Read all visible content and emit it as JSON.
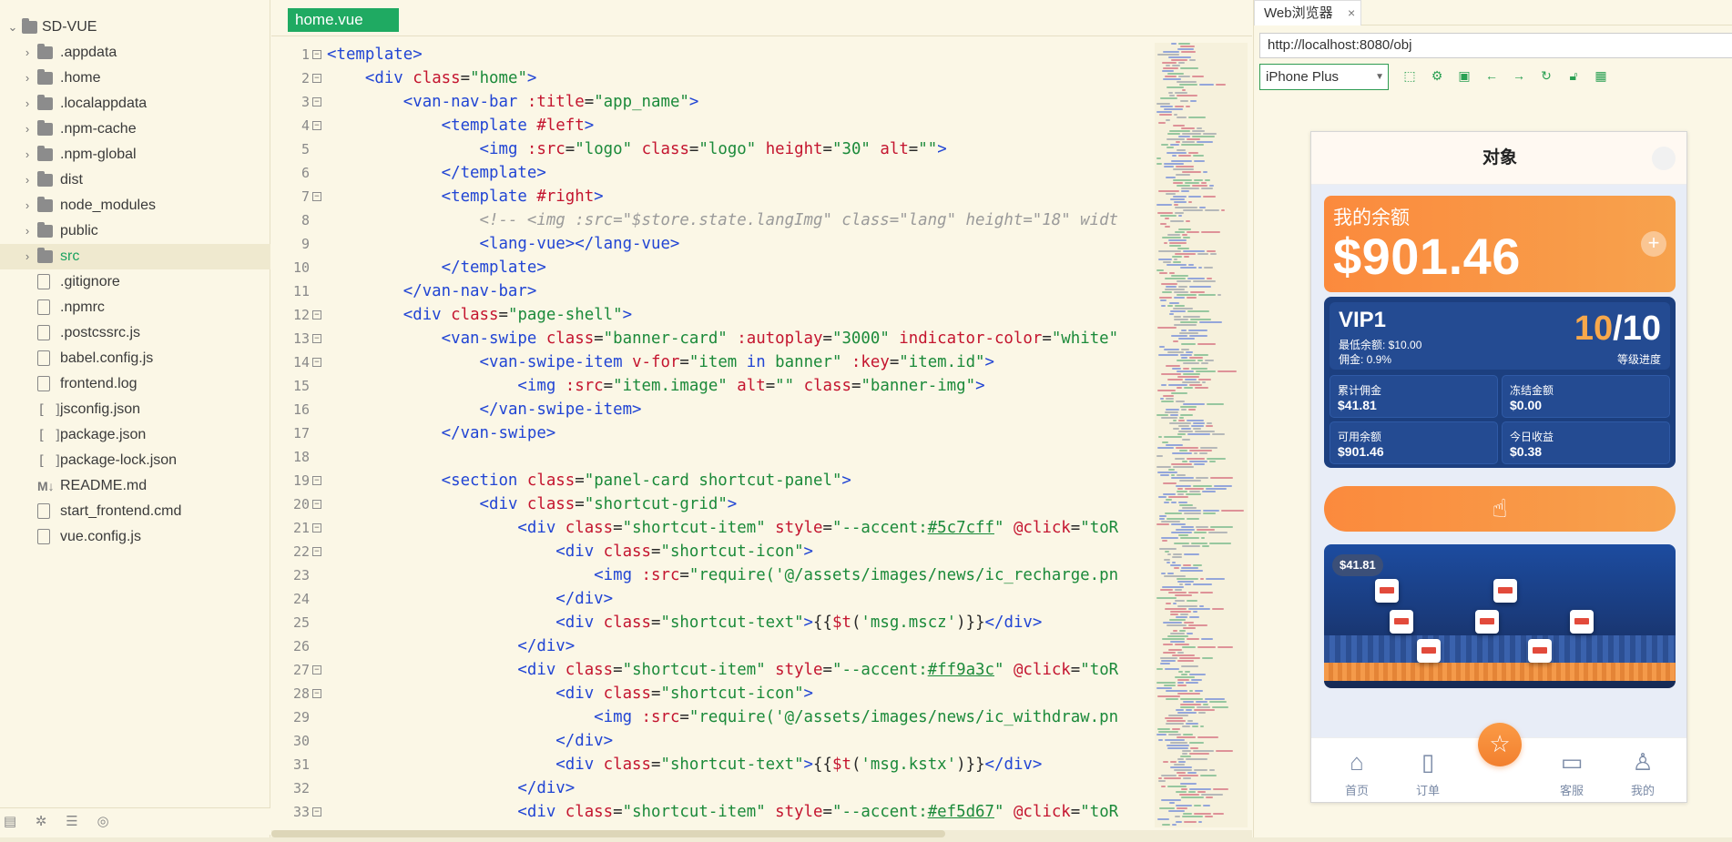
{
  "explorer": {
    "root": "SD-VUE",
    "items": [
      {
        "label": ".appdata",
        "type": "folder"
      },
      {
        "label": ".home",
        "type": "folder"
      },
      {
        "label": ".localappdata",
        "type": "folder"
      },
      {
        "label": ".npm-cache",
        "type": "folder"
      },
      {
        "label": ".npm-global",
        "type": "folder"
      },
      {
        "label": "dist",
        "type": "folder"
      },
      {
        "label": "node_modules",
        "type": "folder"
      },
      {
        "label": "public",
        "type": "folder"
      },
      {
        "label": "src",
        "type": "folder",
        "selected": true
      },
      {
        "label": ".gitignore",
        "type": "file"
      },
      {
        "label": ".npmrc",
        "type": "file"
      },
      {
        "label": ".postcssrc.js",
        "type": "file"
      },
      {
        "label": "babel.config.js",
        "type": "file"
      },
      {
        "label": "frontend.log",
        "type": "file"
      },
      {
        "label": "jsconfig.json",
        "type": "json"
      },
      {
        "label": "package.json",
        "type": "json"
      },
      {
        "label": "package-lock.json",
        "type": "json"
      },
      {
        "label": "README.md",
        "type": "md"
      },
      {
        "label": "start_frontend.cmd",
        "type": "file"
      },
      {
        "label": "vue.config.js",
        "type": "file"
      }
    ]
  },
  "editor": {
    "tab": "home.vue",
    "lines": [
      {
        "n": "1",
        "fold": true,
        "indent": 0,
        "parts": [
          [
            "tg",
            "<template>"
          ]
        ]
      },
      {
        "n": "2",
        "fold": true,
        "indent": 1,
        "parts": [
          [
            "tg",
            "<div "
          ],
          [
            "at",
            "class"
          ],
          [
            "pl",
            "="
          ],
          [
            "sv",
            "\"home\""
          ],
          [
            "tg",
            ">"
          ]
        ]
      },
      {
        "n": "3",
        "fold": true,
        "indent": 2,
        "parts": [
          [
            "tg",
            "<van-nav-bar "
          ],
          [
            "at",
            ":title"
          ],
          [
            "pl",
            "="
          ],
          [
            "sv",
            "\"app_name\""
          ],
          [
            "tg",
            ">"
          ]
        ]
      },
      {
        "n": "4",
        "fold": true,
        "indent": 3,
        "parts": [
          [
            "tg",
            "<template "
          ],
          [
            "at",
            "#left"
          ],
          [
            "tg",
            ">"
          ]
        ]
      },
      {
        "n": "5",
        "fold": false,
        "indent": 4,
        "parts": [
          [
            "tg",
            "<img "
          ],
          [
            "at",
            ":src"
          ],
          [
            "pl",
            "="
          ],
          [
            "sv",
            "\"logo\" "
          ],
          [
            "at",
            "class"
          ],
          [
            "pl",
            "="
          ],
          [
            "sv",
            "\"logo\" "
          ],
          [
            "at",
            "height"
          ],
          [
            "pl",
            "="
          ],
          [
            "sv",
            "\"30\" "
          ],
          [
            "at",
            "alt"
          ],
          [
            "pl",
            "="
          ],
          [
            "sv",
            "\"\""
          ],
          [
            "tg",
            ">"
          ]
        ]
      },
      {
        "n": "6",
        "fold": false,
        "indent": 3,
        "parts": [
          [
            "tg",
            "</template>"
          ]
        ]
      },
      {
        "n": "7",
        "fold": true,
        "indent": 3,
        "parts": [
          [
            "tg",
            "<template "
          ],
          [
            "at",
            "#right"
          ],
          [
            "tg",
            ">"
          ]
        ]
      },
      {
        "n": "8",
        "fold": false,
        "indent": 4,
        "parts": [
          [
            "cm",
            "<!-- <img :src=\"$store.state.langImg\" class=\"lang\" height=\"18\" widt"
          ]
        ]
      },
      {
        "n": "9",
        "fold": false,
        "indent": 4,
        "parts": [
          [
            "tg",
            "<lang-vue></lang-vue>"
          ]
        ]
      },
      {
        "n": "10",
        "fold": false,
        "indent": 3,
        "parts": [
          [
            "tg",
            "</template>"
          ]
        ]
      },
      {
        "n": "11",
        "fold": false,
        "indent": 2,
        "parts": [
          [
            "tg",
            "</van-nav-bar>"
          ]
        ]
      },
      {
        "n": "12",
        "fold": true,
        "indent": 2,
        "parts": [
          [
            "tg",
            "<div "
          ],
          [
            "at",
            "class"
          ],
          [
            "pl",
            "="
          ],
          [
            "sv",
            "\"page-shell\""
          ],
          [
            "tg",
            ">"
          ]
        ]
      },
      {
        "n": "13",
        "fold": true,
        "indent": 3,
        "parts": [
          [
            "tg",
            "<van-swipe "
          ],
          [
            "at",
            "class"
          ],
          [
            "pl",
            "="
          ],
          [
            "sv",
            "\"banner-card\" "
          ],
          [
            "at",
            ":autoplay"
          ],
          [
            "pl",
            "="
          ],
          [
            "sv",
            "\"3000\" "
          ],
          [
            "at",
            "indicator-color"
          ],
          [
            "pl",
            "="
          ],
          [
            "sv",
            "\"white\""
          ]
        ]
      },
      {
        "n": "14",
        "fold": true,
        "indent": 4,
        "parts": [
          [
            "tg",
            "<van-swipe-item "
          ],
          [
            "at",
            "v-for"
          ],
          [
            "pl",
            "="
          ],
          [
            "sv",
            "\"item "
          ],
          [
            "tg",
            "in"
          ],
          [
            "sv",
            " banner\" "
          ],
          [
            "at",
            ":key"
          ],
          [
            "pl",
            "="
          ],
          [
            "sv",
            "\"item.id\""
          ],
          [
            "tg",
            ">"
          ]
        ]
      },
      {
        "n": "15",
        "fold": false,
        "indent": 5,
        "parts": [
          [
            "tg",
            "<img "
          ],
          [
            "at",
            ":src"
          ],
          [
            "pl",
            "="
          ],
          [
            "sv",
            "\"item.image\" "
          ],
          [
            "at",
            "alt"
          ],
          [
            "pl",
            "="
          ],
          [
            "sv",
            "\"\" "
          ],
          [
            "at",
            "class"
          ],
          [
            "pl",
            "="
          ],
          [
            "sv",
            "\"banner-img\""
          ],
          [
            "tg",
            ">"
          ]
        ]
      },
      {
        "n": "16",
        "fold": false,
        "indent": 4,
        "parts": [
          [
            "tg",
            "</van-swipe-item>"
          ]
        ]
      },
      {
        "n": "17",
        "fold": false,
        "indent": 3,
        "parts": [
          [
            "tg",
            "</van-swipe>"
          ]
        ]
      },
      {
        "n": "18",
        "fold": false,
        "indent": 0,
        "parts": []
      },
      {
        "n": "19",
        "fold": true,
        "indent": 3,
        "parts": [
          [
            "tg",
            "<section "
          ],
          [
            "at",
            "class"
          ],
          [
            "pl",
            "="
          ],
          [
            "sv",
            "\"panel-card shortcut-panel\""
          ],
          [
            "tg",
            ">"
          ]
        ]
      },
      {
        "n": "20",
        "fold": true,
        "indent": 4,
        "parts": [
          [
            "tg",
            "<div "
          ],
          [
            "at",
            "class"
          ],
          [
            "pl",
            "="
          ],
          [
            "sv",
            "\"shortcut-grid\""
          ],
          [
            "tg",
            ">"
          ]
        ]
      },
      {
        "n": "21",
        "fold": true,
        "indent": 5,
        "parts": [
          [
            "tg",
            "<div "
          ],
          [
            "at",
            "class"
          ],
          [
            "pl",
            "="
          ],
          [
            "sv",
            "\"shortcut-item\" "
          ],
          [
            "at",
            "style"
          ],
          [
            "pl",
            "="
          ],
          [
            "sv",
            "\"--accent:"
          ],
          [
            "ul",
            "#5c7cff"
          ],
          [
            "sv",
            "\" "
          ],
          [
            "at",
            "@click"
          ],
          [
            "pl",
            "="
          ],
          [
            "sv",
            "\"toR"
          ]
        ]
      },
      {
        "n": "22",
        "fold": true,
        "indent": 6,
        "parts": [
          [
            "tg",
            "<div "
          ],
          [
            "at",
            "class"
          ],
          [
            "pl",
            "="
          ],
          [
            "sv",
            "\"shortcut-icon\""
          ],
          [
            "tg",
            ">"
          ]
        ]
      },
      {
        "n": "23",
        "fold": false,
        "indent": 7,
        "parts": [
          [
            "tg",
            "<img "
          ],
          [
            "at",
            ":src"
          ],
          [
            "pl",
            "="
          ],
          [
            "sv",
            "\"require('@/assets/images/news/ic_recharge.pn"
          ]
        ]
      },
      {
        "n": "24",
        "fold": false,
        "indent": 6,
        "parts": [
          [
            "tg",
            "</div>"
          ]
        ]
      },
      {
        "n": "25",
        "fold": false,
        "indent": 6,
        "parts": [
          [
            "tg",
            "<div "
          ],
          [
            "at",
            "class"
          ],
          [
            "pl",
            "="
          ],
          [
            "sv",
            "\"shortcut-text\""
          ],
          [
            "tg",
            ">"
          ],
          [
            "pl",
            "{{"
          ],
          [
            "at",
            "$t"
          ],
          [
            "pl",
            "("
          ],
          [
            "sv",
            "'msg.mscz'"
          ],
          [
            "pl",
            ")}}"
          ],
          [
            "tg",
            "</div>"
          ]
        ]
      },
      {
        "n": "26",
        "fold": false,
        "indent": 5,
        "parts": [
          [
            "tg",
            "</div>"
          ]
        ]
      },
      {
        "n": "27",
        "fold": true,
        "indent": 5,
        "parts": [
          [
            "tg",
            "<div "
          ],
          [
            "at",
            "class"
          ],
          [
            "pl",
            "="
          ],
          [
            "sv",
            "\"shortcut-item\" "
          ],
          [
            "at",
            "style"
          ],
          [
            "pl",
            "="
          ],
          [
            "sv",
            "\"--accent:"
          ],
          [
            "ul",
            "#ff9a3c"
          ],
          [
            "sv",
            "\" "
          ],
          [
            "at",
            "@click"
          ],
          [
            "pl",
            "="
          ],
          [
            "sv",
            "\"toR"
          ]
        ]
      },
      {
        "n": "28",
        "fold": true,
        "indent": 6,
        "parts": [
          [
            "tg",
            "<div "
          ],
          [
            "at",
            "class"
          ],
          [
            "pl",
            "="
          ],
          [
            "sv",
            "\"shortcut-icon\""
          ],
          [
            "tg",
            ">"
          ]
        ]
      },
      {
        "n": "29",
        "fold": false,
        "indent": 7,
        "parts": [
          [
            "tg",
            "<img "
          ],
          [
            "at",
            ":src"
          ],
          [
            "pl",
            "="
          ],
          [
            "sv",
            "\"require('@/assets/images/news/ic_withdraw.pn"
          ]
        ]
      },
      {
        "n": "30",
        "fold": false,
        "indent": 6,
        "parts": [
          [
            "tg",
            "</div>"
          ]
        ]
      },
      {
        "n": "31",
        "fold": false,
        "indent": 6,
        "parts": [
          [
            "tg",
            "<div "
          ],
          [
            "at",
            "class"
          ],
          [
            "pl",
            "="
          ],
          [
            "sv",
            "\"shortcut-text\""
          ],
          [
            "tg",
            ">"
          ],
          [
            "pl",
            "{{"
          ],
          [
            "at",
            "$t"
          ],
          [
            "pl",
            "("
          ],
          [
            "sv",
            "'msg.kstx'"
          ],
          [
            "pl",
            ")}}"
          ],
          [
            "tg",
            "</div>"
          ]
        ]
      },
      {
        "n": "32",
        "fold": false,
        "indent": 5,
        "parts": [
          [
            "tg",
            "</div>"
          ]
        ]
      },
      {
        "n": "33",
        "fold": true,
        "indent": 5,
        "parts": [
          [
            "tg",
            "<div "
          ],
          [
            "at",
            "class"
          ],
          [
            "pl",
            "="
          ],
          [
            "sv",
            "\"shortcut-item\" "
          ],
          [
            "at",
            "style"
          ],
          [
            "pl",
            "="
          ],
          [
            "sv",
            "\"--accent:"
          ],
          [
            "ul",
            "#ef5d67"
          ],
          [
            "sv",
            "\" "
          ],
          [
            "at",
            "@click"
          ],
          [
            "pl",
            "="
          ],
          [
            "sv",
            "\"toR"
          ]
        ]
      }
    ]
  },
  "browser": {
    "tab_title": "Web浏览器",
    "tab_close": "×",
    "url": "http://localhost:8080/obj",
    "device": "iPhone Plus",
    "toolbar_icons": [
      "screenshot-icon",
      "settings-icon",
      "console-icon",
      "back-icon",
      "forward-icon",
      "reload-icon",
      "lock-icon",
      "qrcode-icon"
    ]
  },
  "phone": {
    "title": "对象",
    "balance_label": "我的余额",
    "balance_amount": "$901.46",
    "add_symbol": "+",
    "vip_title": "VIP1",
    "vip_min_balance": "最低余额: $10.00",
    "vip_commission": "佣金: 0.9%",
    "vip_progress_done": "10",
    "vip_progress_total": "/10",
    "vip_level_label": "等级进度",
    "stats": [
      {
        "label": "累计佣金",
        "value": "$41.81"
      },
      {
        "label": "冻结金额",
        "value": "$0.00"
      },
      {
        "label": "可用余额",
        "value": "$901.46"
      },
      {
        "label": "今日收益",
        "value": "$0.38"
      }
    ],
    "banner_badge": "$41.81",
    "tabs": [
      {
        "label": "首页",
        "icon": "home-icon"
      },
      {
        "label": "订单",
        "icon": "order-icon"
      },
      {
        "label": "客服",
        "icon": "chat-icon"
      },
      {
        "label": "我的",
        "icon": "user-icon"
      }
    ],
    "fab_icon": "star-icon",
    "tap_icon": "hand-tap-icon"
  },
  "colors": {
    "accent_green": "#1faa62",
    "orange": "#fb8a3d",
    "navy": "#1c3f7f"
  }
}
